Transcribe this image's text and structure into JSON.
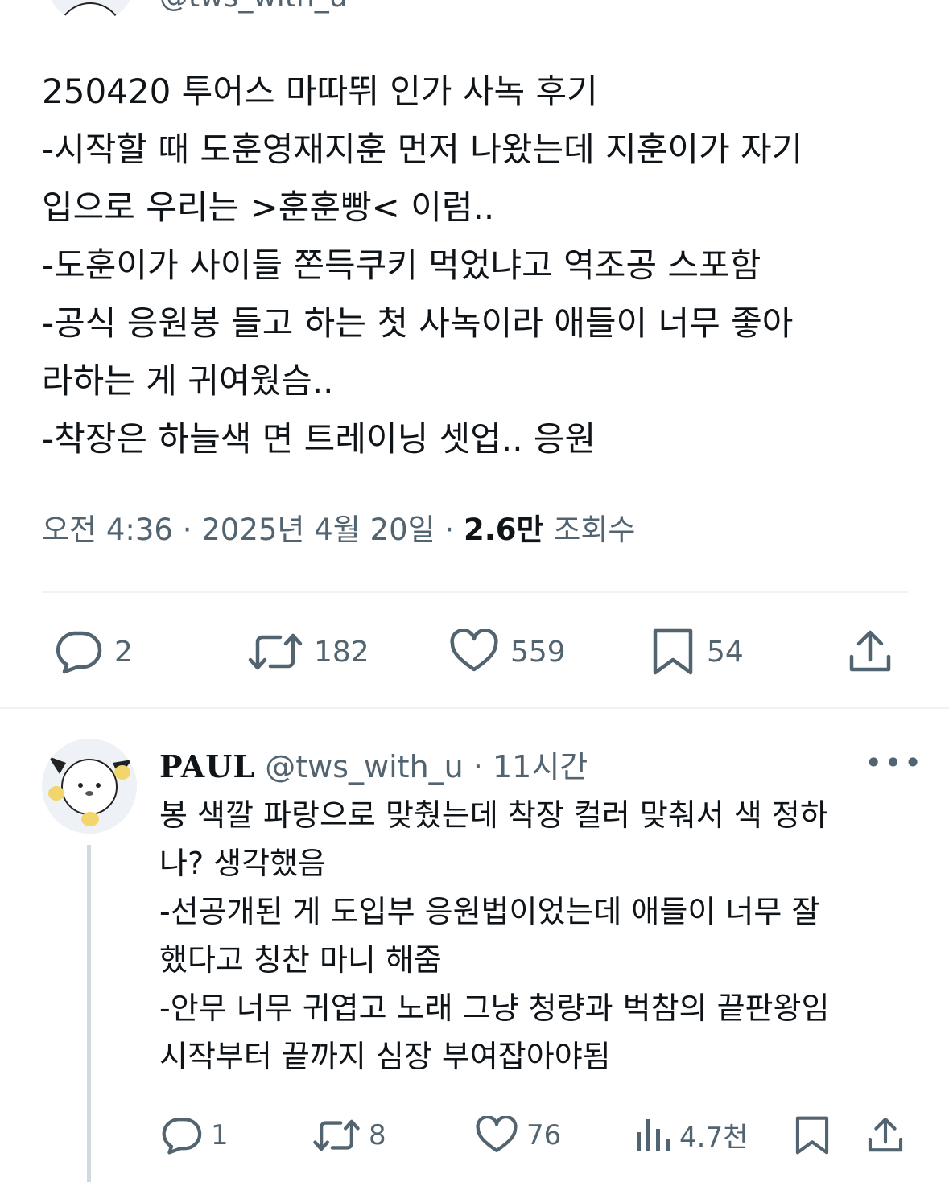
{
  "header": {
    "handle": "@tws_with_u"
  },
  "tweet": {
    "lines": [
      "250420 투어스 마따뛰 인가 사녹 후기",
      "-시작할 때 도훈영재지훈 먼저 나왔는데 지훈이가 자기",
      "입으로 우리는 >훈훈빵< 이럼..",
      "-도훈이가 사이들 쫀득쿠키 먹었냐고 역조공 스포함",
      "-공식 응원봉 들고 하는 첫 사녹이라 애들이 너무 좋아",
      "라하는 게 귀여웠슴..",
      "-착장은 하늘색 면 트레이닝 셋업.. 응원"
    ],
    "time": "오전 4:36",
    "sep1": " · ",
    "date": "2025년 4월 20일",
    "sep2": " · ",
    "views_count": "2.6만",
    "views_label": " 조회수",
    "actions": {
      "replies": "2",
      "retweets": "182",
      "likes": "559",
      "bookmarks": "54"
    }
  },
  "reply": {
    "name": "PAUL",
    "handle": "@tws_with_u",
    "sep": " · ",
    "time": "11시간",
    "more": "•••",
    "lines": [
      "봉 색깔 파랑으로 맞췄는데 착장 컬러 맞춰서 색 정하",
      "나? 생각했음",
      "-선공개된 게 도입부 응원법이었는데 애들이 너무 잘",
      "했다고 칭찬 마니 해줌",
      "-안무 너무 귀엽고 노래 그냥 청량과 벅참의 끝판왕임",
      "시작부터 끝까지 심장 부여잡아야됨"
    ],
    "actions": {
      "replies": "1",
      "retweets": "8",
      "likes": "76",
      "views": "4.7천"
    }
  },
  "colors": {
    "text": "#0f1419",
    "secondary": "#536471",
    "divider": "#eff3f4",
    "thread_line": "#cfd9de"
  }
}
